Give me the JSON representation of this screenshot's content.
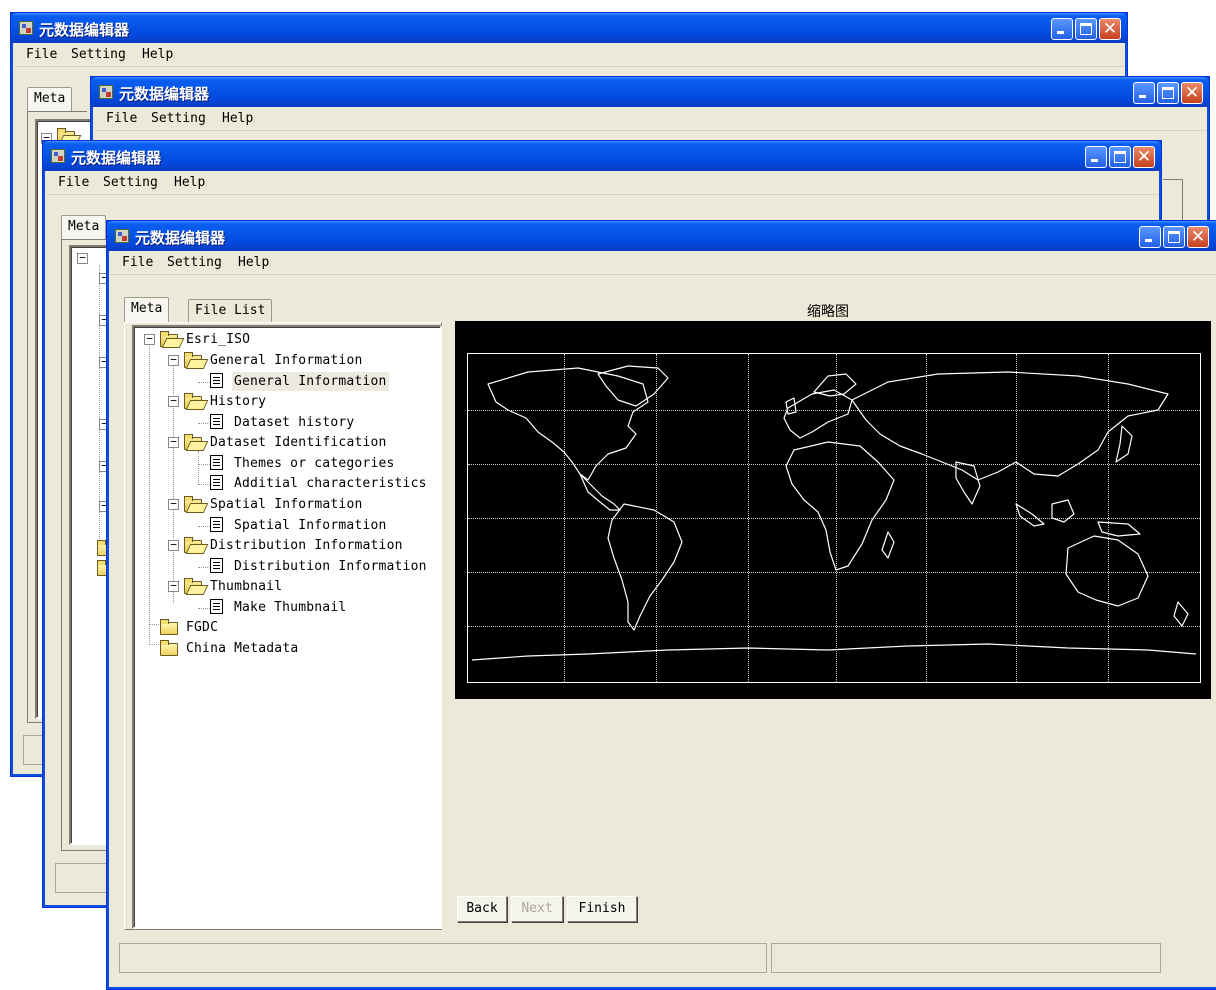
{
  "window": {
    "title": "元数据编辑器"
  },
  "menu": {
    "file": "File",
    "setting": "Setting",
    "help": "Help"
  },
  "tabs": {
    "meta": "Meta",
    "file_list": "File List"
  },
  "tree": {
    "root": "Esri_ISO",
    "general_information": "General Information",
    "general_information_child": "General Information",
    "history": "History",
    "dataset_history": "Dataset history",
    "dataset_identification": "Dataset Identification",
    "themes_or_categories": "Themes or categories",
    "additial_characteristics": "Additial characteristics",
    "spatial_information": "Spatial Information",
    "spatial_information_child": "Spatial Information",
    "distribution_information": "Distribution Information",
    "distribution_information_child": "Distribution Information",
    "thumbnail": "Thumbnail",
    "make_thumbnail": "Make Thumbnail",
    "fgdc": "FGDC",
    "china_metadata": "China Metadata"
  },
  "preview": {
    "title": "缩略图"
  },
  "buttons": {
    "back": "Back",
    "next": "Next",
    "finish": "Finish"
  },
  "icons": {
    "minimize": "minimize-icon",
    "maximize": "maximize-icon",
    "close": "close-icon",
    "folder": "folder-icon",
    "document": "document-icon"
  },
  "colors": {
    "titlebar": "#0554e6",
    "window_bg": "#ece9d8",
    "map_bg": "#000000",
    "map_lines": "#ffffff"
  }
}
